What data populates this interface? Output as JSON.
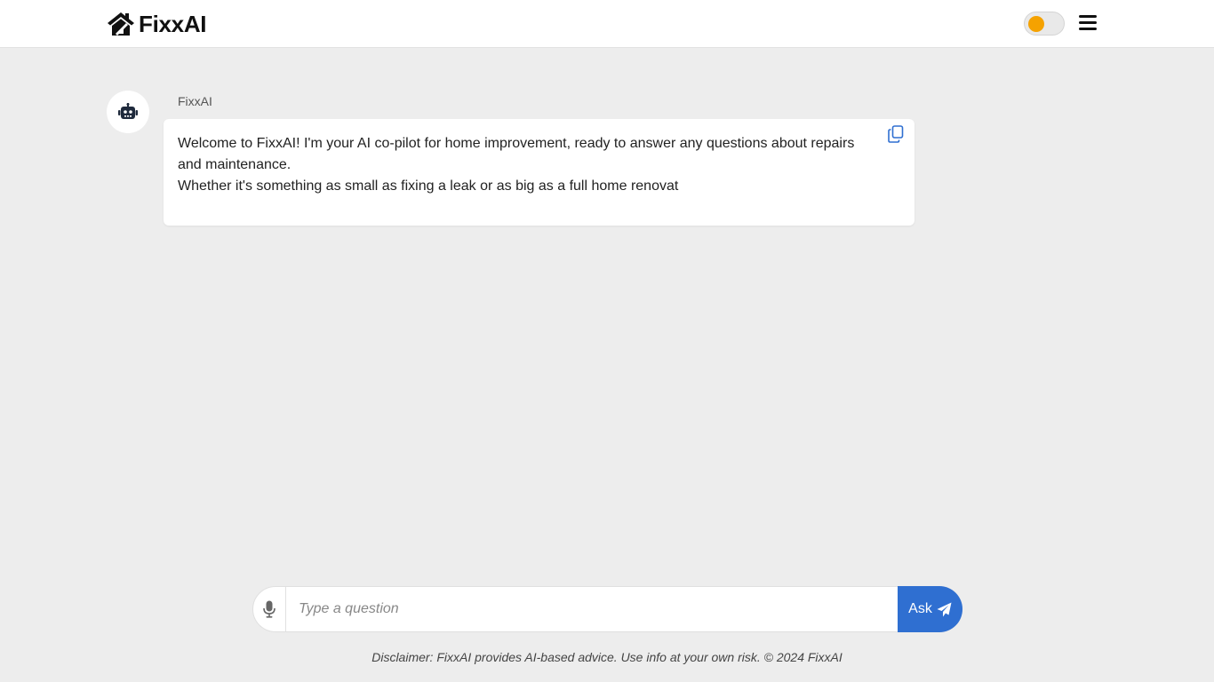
{
  "brand": {
    "name": "FixxAI",
    "icon": "house-icon"
  },
  "header": {
    "theme_toggle": {
      "icon": "theme-toggle",
      "knob_color": "#f5a200",
      "state": "light"
    },
    "menu_icon": "hamburger-menu-icon"
  },
  "chat": {
    "sender": "FixxAI",
    "avatar_icon": "robot-icon",
    "message_lines": [
      "Welcome to FixxAI! I'm your AI co-pilot for home improvement, ready to answer any questions about repairs and maintenance.",
      "Whether it's something as small as fixing a leak or as big as a full home renovat"
    ],
    "copy_icon": "copy-icon"
  },
  "composer": {
    "mic_icon": "microphone-icon",
    "placeholder": "Type a question",
    "value": "",
    "ask_label": "Ask",
    "ask_icon": "paper-plane-icon",
    "accent_color": "#2f6fd1"
  },
  "footer": {
    "disclaimer": "Disclaimer: FixxAI provides AI-based advice. Use info at your own risk. © 2024 FixxAI"
  }
}
